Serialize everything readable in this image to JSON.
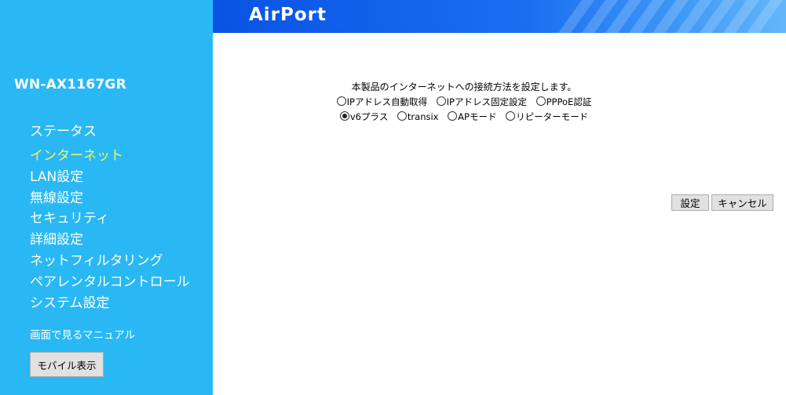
{
  "sidebar": {
    "model": "WN-AX1167GR",
    "menu": [
      "ステータス",
      "インターネット",
      "LAN設定",
      "無線設定",
      "セキュリティ",
      "詳細設定",
      "ネットフィルタリング",
      "ペアレンタルコントロール",
      "システム設定"
    ],
    "active_item": "インターネット",
    "manual_link": "画面で見るマニュアル",
    "mobile_button": "モバイル表示"
  },
  "header": {
    "logo": "AirPort"
  },
  "main": {
    "intro": "本製品のインターネットへの接続方法を設定します。",
    "options_row1": [
      {
        "label": "IPアドレス自動取得",
        "selected": false
      },
      {
        "label": "IPアドレス固定設定",
        "selected": false
      },
      {
        "label": "PPPoE認証",
        "selected": false
      }
    ],
    "options_row2": [
      {
        "label": "v6プラス",
        "selected": true
      },
      {
        "label": "transix",
        "selected": false
      },
      {
        "label": "APモード",
        "selected": false
      },
      {
        "label": "リピーターモード",
        "selected": false
      }
    ],
    "set_button": "設定",
    "cancel_button": "キャンセル"
  },
  "colors": {
    "sidebar_bg": "#29b8f4",
    "header_blue": "#0f5ee8",
    "active_menu": "#f4f46a"
  }
}
